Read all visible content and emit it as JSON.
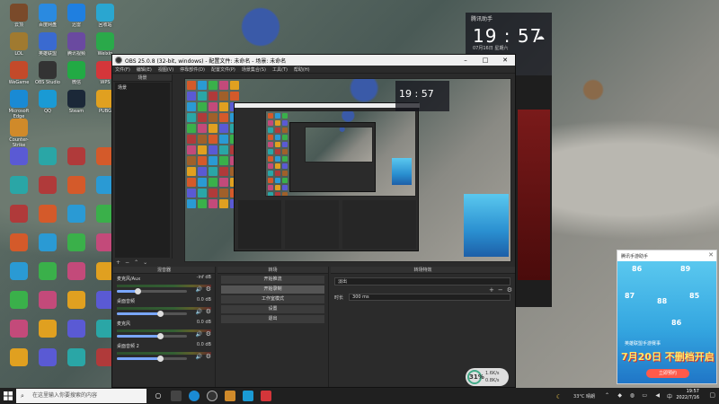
{
  "desktop": {
    "icons": [
      {
        "label": "云顶",
        "color": "#7a4a2a"
      },
      {
        "label": "百度网盘",
        "color": "#2a8ae0"
      },
      {
        "label": "迅雷",
        "color": "#1f7fe0"
      },
      {
        "label": "回收站",
        "color": "#2aa6d0"
      },
      {
        "label": "LOL",
        "color": "#a07a30"
      },
      {
        "label": "英雄联盟",
        "color": "#3a6ad0"
      },
      {
        "label": "腾讯视频",
        "color": "#6a4aa0"
      },
      {
        "label": "Weixin",
        "color": "#2aa94a"
      },
      {
        "label": "WeGame",
        "color": "#c34a2a"
      },
      {
        "label": "OBS Studio",
        "color": "#333"
      },
      {
        "label": "微信",
        "color": "#22aa44"
      },
      {
        "label": "WPS",
        "color": "#d4363a"
      },
      {
        "label": "Microsoft Edge",
        "color": "#1a8ad4"
      },
      {
        "label": "QQ",
        "color": "#1a9ad4"
      },
      {
        "label": "Steam",
        "color": "#1b2838"
      },
      {
        "label": "PUBG",
        "color": "#e0a020"
      },
      {
        "label": "Counter-Strike",
        "color": "#d08a2a"
      }
    ]
  },
  "clock_widget": {
    "title": "腾讯助手",
    "time": "19 : 57",
    "date": "07月16日 星期六"
  },
  "obs": {
    "title": "OBS 25.0.8 (32-bit, windows) - 配置文件: 未命名 - 场景: 未命名",
    "menu": [
      "文件(F)",
      "编辑(E)",
      "视图(V)",
      "停靠部件(D)",
      "配置文件(P)",
      "场景集合(S)",
      "工具(T)",
      "帮助(H)"
    ],
    "scenes": {
      "header": "场景",
      "items": [
        "场景"
      ]
    },
    "docks": {
      "mixer_header": "混音器",
      "transitions_header": "转场",
      "controls_header": "转场特效",
      "tracks": [
        {
          "name": "麦克风/Aux",
          "db": "-inf dB",
          "level": 0.3
        },
        {
          "name": "桌面音频",
          "db": "0.0 dB",
          "level": 0.62
        },
        {
          "name": "麦克风",
          "db": "0.0 dB",
          "level": 0.62
        },
        {
          "name": "桌面音频 2",
          "db": "0.0 dB",
          "level": 0.62
        }
      ],
      "transition_items": [
        "开始推流",
        "开始录制",
        "工作室模式",
        "设置",
        "退出"
      ],
      "controls": {
        "fade_label": "淡出",
        "duration_label": "时长",
        "duration_value": "300 ms"
      }
    }
  },
  "ad": {
    "header": "腾讯手游助手",
    "headline": "英雄联盟手游赛事",
    "title": "7月20日 不删档开启",
    "button": "立即预约",
    "numbers": [
      "86",
      "89",
      "87",
      "88",
      "85",
      "86"
    ]
  },
  "perf": {
    "percent": "31%",
    "up": "1.6K/s",
    "down": "0.8K/s"
  },
  "taskbar": {
    "search_placeholder": "在这里输入你要搜索的内容",
    "temp": "33°C 晴朗",
    "time": "19:57",
    "date": "2022/7/16",
    "ime": "中"
  }
}
